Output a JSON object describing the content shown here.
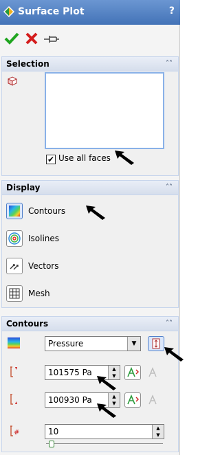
{
  "titlebar": {
    "title": "Surface Plot",
    "help": "?"
  },
  "toolbar": {
    "ok_icon": "checkmark-icon",
    "cancel_icon": "x-icon",
    "pin_icon": "pushpin-icon"
  },
  "selection": {
    "header": "Selection",
    "use_all_faces_label": "Use all faces",
    "use_all_faces_checked": true
  },
  "display": {
    "header": "Display",
    "items": [
      {
        "label": "Contours"
      },
      {
        "label": "Isolines"
      },
      {
        "label": "Vectors"
      },
      {
        "label": "Mesh"
      }
    ]
  },
  "contours": {
    "header": "Contours",
    "parameter": "Pressure",
    "max_value": "101575 Pa",
    "min_value": "100930 Pa",
    "levels": "10"
  }
}
